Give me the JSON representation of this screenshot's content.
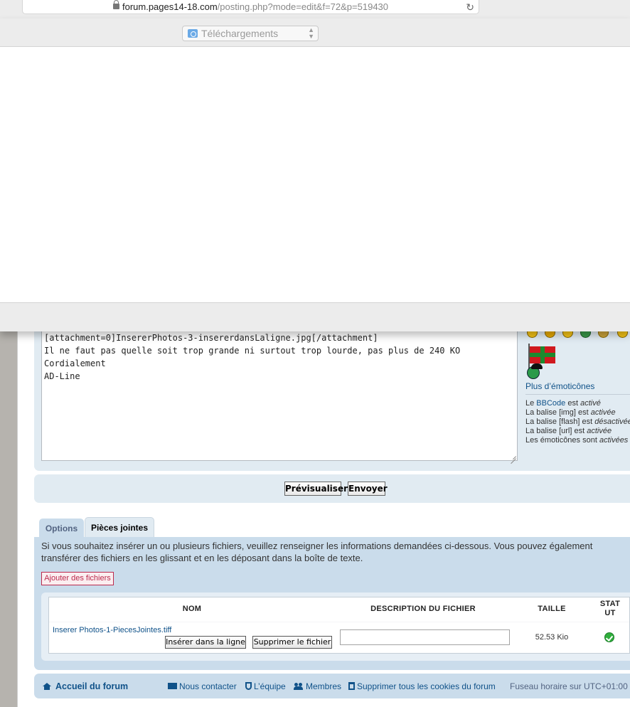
{
  "browser": {
    "host": "forum.pages14-18.com",
    "path": "/posting.php?mode=edit&f=72&p=519430"
  },
  "save_dialog": {
    "location": "Téléchargements"
  },
  "editor": {
    "message": "[attachment=0]InsererPhotos-3-insererdansLaligne.jpg[/attachment]\nIl ne faut pas quelle soit trop grande ni surtout trop lourde, pas plus de 240 KO\nCordialement\nAD-Line",
    "more_smilies": "Plus d’émoticônes",
    "status": {
      "bbcode_prefix": "Le ",
      "bbcode_link": "BBCode",
      "bbcode_suffix": " est ",
      "bbcode_state": "activé",
      "img_prefix": "La balise [img] est ",
      "img_state": "activée",
      "flash_prefix": "La balise [flash] est ",
      "flash_state": "désactivée",
      "url_prefix": "La balise [url] est ",
      "url_state": "activée",
      "smilies_prefix": "Les émoticônes sont ",
      "smilies_state": "activées"
    }
  },
  "buttons": {
    "preview": "Prévisualiser",
    "submit": "Envoyer"
  },
  "tabs": [
    {
      "label": "Options",
      "active": false
    },
    {
      "label": "Pièces jointes",
      "active": true
    }
  ],
  "attachments": {
    "help": "Si vous souhaitez insérer un ou plusieurs fichiers, veuillez renseigner les informations demandées ci-dessous. Vous pouvez également transférer des fichiers en les glissant et en les déposant dans la boîte de texte.",
    "add_files": "Ajouter des fichiers",
    "columns": {
      "name": "NOM",
      "description": "DESCRIPTION DU FICHIER",
      "size": "TAILLE",
      "status": "STAT\nUT"
    },
    "files": [
      {
        "name": "Inserer Photos-1-PiecesJointes.tiff",
        "insert_label": "Insérer dans la ligne",
        "delete_label": "Supprimer le fichier",
        "description": "",
        "size": "52.53 Kio",
        "status_icon": "check-circle-icon"
      }
    ]
  },
  "footer": {
    "home": "Accueil du forum",
    "contact": "Nous contacter",
    "team": "L’équipe",
    "members": "Membres",
    "cookies": "Supprimer tous les cookies du forum",
    "timezone": "Fuseau horaire sur UTC+01:00"
  }
}
